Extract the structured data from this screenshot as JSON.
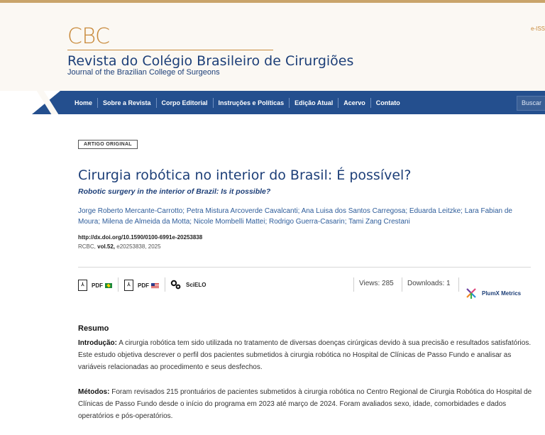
{
  "header": {
    "logo": "CBC",
    "journal_pt": "Revista do Colégio Brasileiro de Cirurgiões",
    "journal_en": "Journal of the Brazilian College of Surgeons",
    "eissn": "e-ISS"
  },
  "nav": {
    "items": [
      "Home",
      "Sobre a Revista",
      "Corpo Editorial",
      "Instruções e Políticas",
      "Edição Atual",
      "Acervo",
      "Contato"
    ],
    "search_label": "Buscar"
  },
  "article": {
    "badge": "ARTIGO ORIGINAL",
    "title_pt": "Cirurgia robótica no interior do Brasil: É possível?",
    "title_en": "Robotic surgery in the interior of Brazil: Is it possible?",
    "authors": "Jorge Roberto Mercante-Carrotto; Petra Mistura Arcoverde Cavalcanti; Ana Luisa dos Santos Carregosa; Eduarda Leitzke; Lara Fabian de Moura; Milena de Almeida da Motta; Nicole Mombelli Mattei; Rodrigo Guerra-Casarin; Tami Zang Crestani",
    "doi": "http://dx.doi.org/10.1590/0100-6991e-20253838",
    "cite_prefix": "RCBC,",
    "cite_vol": "vol.52,",
    "cite_rest": "e20253838, 2025"
  },
  "tools": {
    "pdf_pt": "PDF",
    "pdf_en": "PDF",
    "scielo": "SciELO",
    "views": "Views: 285",
    "downloads": "Downloads: 1",
    "plumx": "PlumX Metrics"
  },
  "abstract": {
    "heading": "Resumo",
    "intro_label": "Introdução:",
    "intro_text": "A cirurgia robótica tem sido utilizada no tratamento de diversas doenças cirúrgicas devido à sua precisão e resultados satisfatórios. Este estudo objetiva descrever o perfil dos pacientes submetidos à cirurgia robótica no Hospital de Clínicas de Passo Fundo e analisar as variáveis relacionadas ao procedimento e seus desfechos.",
    "methods_label": "Métodos:",
    "methods_text": "Foram revisados 215 prontuários de pacientes submetidos à cirurgia robótica no Centro Regional de Cirurgia Robótica do Hospital de Clínicas de Passo Fundo desde o início do programa em 2023 até março de 2024. Foram avaliados sexo, idade, comorbidades e dados operatórios e pós-operatórios."
  },
  "colors": {
    "navy": "#244f8e",
    "gold": "#c8893a"
  }
}
